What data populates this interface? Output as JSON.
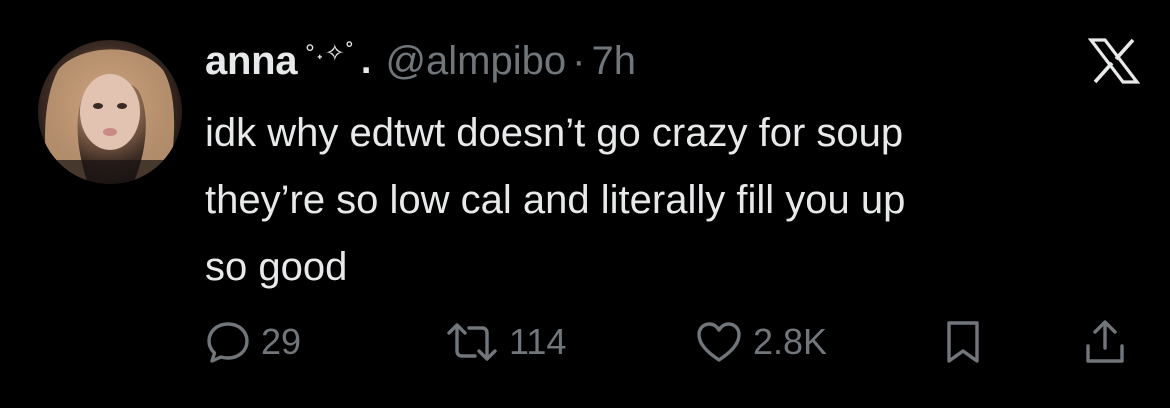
{
  "tweet": {
    "author": {
      "display_name": "anna",
      "name_decoration": "°˖✧˚",
      "name_dot": ".",
      "handle": "@almpibo",
      "separator": "·",
      "time": "7h"
    },
    "text_lines": [
      "idk why edtwt doesn’t go crazy for soup",
      "they’re so low cal and literally fill you up",
      "so good"
    ],
    "actions": {
      "replies": "29",
      "retweets": "114",
      "likes": "2.8K"
    }
  },
  "icons": {
    "logo": "x-logo-icon",
    "reply": "reply-icon",
    "retweet": "retweet-icon",
    "like": "heart-icon",
    "bookmark": "bookmark-icon",
    "share": "share-icon"
  },
  "colors": {
    "background": "#000000",
    "primary_text": "#e7e9ea",
    "secondary_text": "#71767b"
  }
}
